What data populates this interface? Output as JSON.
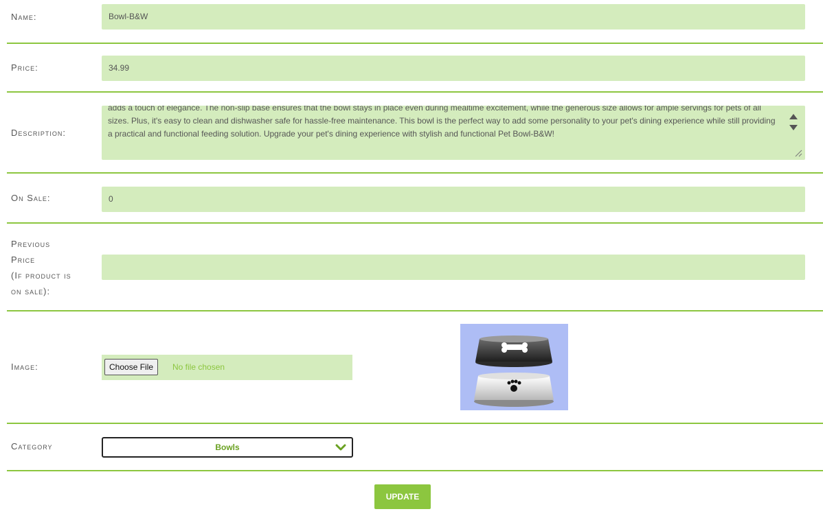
{
  "fields": {
    "name": {
      "label": "Name:",
      "value": "Bowl-B&W"
    },
    "price": {
      "label": "Price:",
      "value": "34.99"
    },
    "description": {
      "label": "Description:",
      "value": "adds a touch of elegance. The non-slip base ensures that the bowl stays in place even during mealtime excitement, while the generous size allows for ample servings for pets of all sizes. Plus, it's easy to clean and dishwasher safe for hassle-free maintenance. This bowl is the perfect way to add some personality to your pet's dining experience while still providing a practical and functional feeding solution. Upgrade your pet's dining experience with stylish and functional Pet Bowl-B&W!"
    },
    "on_sale": {
      "label": "On Sale:",
      "value": "0"
    },
    "previous_price": {
      "label_lines": [
        "Previous",
        "Price",
        "(If product is",
        "on sale):"
      ],
      "value": ""
    },
    "image": {
      "label": "Image:",
      "choose_label": "Choose File",
      "status": "No file chosen"
    },
    "category": {
      "label": "Category",
      "selected": "Bowls"
    }
  },
  "update_label": "UPDATE",
  "colors": {
    "accent": "#8cc63f",
    "field_bg": "#d4ecbd",
    "label": "#555555"
  }
}
